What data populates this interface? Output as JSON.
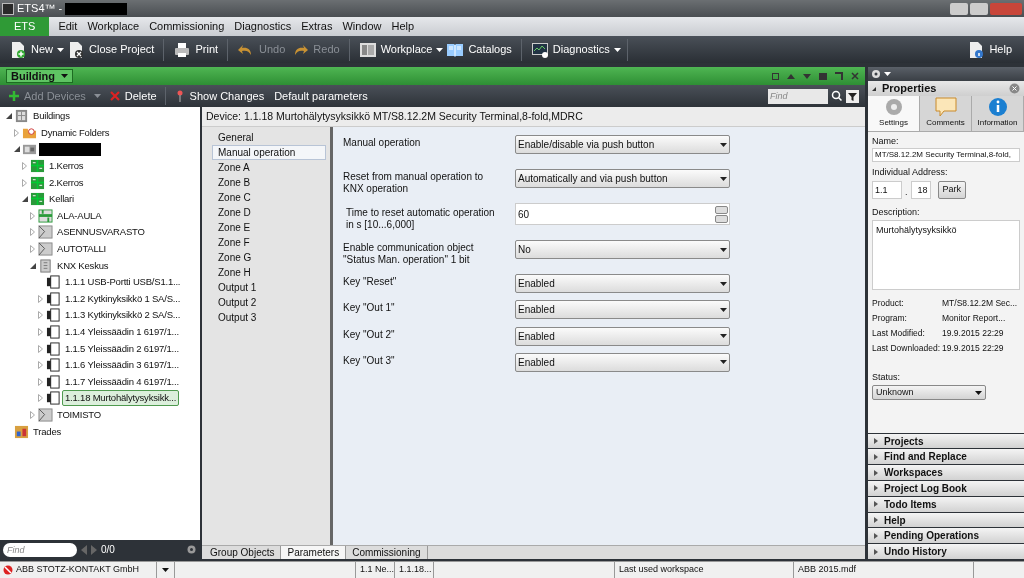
{
  "title_bar": {
    "title": "ETS4™ -"
  },
  "menu": [
    {
      "label": "ETS",
      "selected": true
    },
    {
      "label": "Edit",
      "selected": false
    },
    {
      "label": "Workplace",
      "selected": false
    },
    {
      "label": "Commissioning",
      "selected": false
    },
    {
      "label": "Diagnostics",
      "selected": false
    },
    {
      "label": "Extras",
      "selected": false
    },
    {
      "label": "Window",
      "selected": false
    },
    {
      "label": "Help",
      "selected": false
    }
  ],
  "toolbar": [
    {
      "label": "New",
      "disabled": false,
      "dropdown": true
    },
    {
      "label": "Close Project",
      "disabled": false,
      "dropdown": false
    },
    {
      "label": "Print",
      "disabled": false,
      "dropdown": false
    },
    {
      "label": "Undo",
      "disabled": true,
      "dropdown": false
    },
    {
      "label": "Redo",
      "disabled": true,
      "dropdown": false
    },
    {
      "label": "Workplace",
      "disabled": false,
      "dropdown": true
    },
    {
      "label": "Catalogs",
      "disabled": false,
      "dropdown": false
    },
    {
      "label": "Diagnostics",
      "disabled": false,
      "dropdown": true
    }
  ],
  "toolbar_right": {
    "label": "Help"
  },
  "building_panel": {
    "title": "Building",
    "actions": [
      {
        "label": "Add Devices",
        "disabled": true,
        "dropdown": true
      },
      {
        "label": "Delete",
        "disabled": false,
        "dropdown": false
      },
      {
        "label": "Show Changes",
        "disabled": false,
        "dropdown": false
      },
      {
        "label": "Default parameters",
        "disabled": false,
        "dropdown": false
      }
    ],
    "find_placeholder": "Find"
  },
  "tree": [
    {
      "label": "Buildings",
      "kind": "building",
      "expanded": true,
      "selected": false,
      "children": [
        {
          "label": "Dynamic Folders",
          "kind": "folder",
          "expanded": false,
          "selected": false
        },
        {
          "kind": "building-part",
          "expanded": true,
          "selected": false,
          "children": [
            {
              "label": "1.Kerros",
              "kind": "floor",
              "expanded": false,
              "selected": false
            },
            {
              "label": "2.Kerros",
              "kind": "floor",
              "expanded": false,
              "selected": false
            },
            {
              "label": "Kellari",
              "kind": "floor",
              "expanded": true,
              "selected": false,
              "children": [
                {
                  "label": "ALA-AULA",
                  "kind": "corridor",
                  "expanded": false,
                  "selected": false
                },
                {
                  "label": "ASENNUSVARASTO",
                  "kind": "room",
                  "expanded": false,
                  "selected": false
                },
                {
                  "label": "AUTOTALLI",
                  "kind": "room",
                  "expanded": false,
                  "selected": false
                },
                {
                  "label": "KNX Keskus",
                  "kind": "cabinet",
                  "expanded": true,
                  "selected": false,
                  "children": [
                    {
                      "label": "1.1.1 USB-Portti USB/S1.1...",
                      "kind": "device",
                      "selected": false
                    },
                    {
                      "label": "1.1.2 Kytkinyksikkö 1 SA/S...",
                      "kind": "device",
                      "expanded": false,
                      "selected": false
                    },
                    {
                      "label": "1.1.3 Kytkinyksikkö 2 SA/S...",
                      "kind": "device",
                      "expanded": false,
                      "selected": false
                    },
                    {
                      "label": "1.1.4 Yleissäädin 1 6197/1...",
                      "kind": "device",
                      "expanded": false,
                      "selected": false
                    },
                    {
                      "label": "1.1.5 Yleissäädin 2 6197/1...",
                      "kind": "device",
                      "expanded": false,
                      "selected": false
                    },
                    {
                      "label": "1.1.6 Yleissäädin 3 6197/1...",
                      "kind": "device",
                      "expanded": false,
                      "selected": false
                    },
                    {
                      "label": "1.1.7 Yleissäädin 4 6197/1...",
                      "kind": "device",
                      "expanded": false,
                      "selected": false
                    },
                    {
                      "label": "1.1.18 Murtohälytysyksikk...",
                      "kind": "device",
                      "expanded": false,
                      "selected": true
                    }
                  ]
                },
                {
                  "label": "TOIMISTO",
                  "kind": "room",
                  "expanded": false,
                  "selected": false
                }
              ]
            }
          ]
        }
      ]
    },
    {
      "label": "Trades",
      "kind": "trades",
      "selected": false
    }
  ],
  "tree_footer": {
    "find_placeholder": "Find",
    "count": "0/0"
  },
  "device_header": "Device: 1.1.18 Murtohälytysyksikkö MT/S8.12.2M Security Terminal,8-fold,MDRC",
  "param_pages": [
    {
      "label": "General",
      "selected": false
    },
    {
      "label": "Manual operation",
      "selected": true
    },
    {
      "label": "Zone A",
      "selected": false
    },
    {
      "label": "Zone B",
      "selected": false
    },
    {
      "label": "Zone C",
      "selected": false
    },
    {
      "label": "Zone D",
      "selected": false
    },
    {
      "label": "Zone E",
      "selected": false
    },
    {
      "label": "Zone F",
      "selected": false
    },
    {
      "label": "Zone G",
      "selected": false
    },
    {
      "label": "Zone H",
      "selected": false
    },
    {
      "label": "Output 1",
      "selected": false
    },
    {
      "label": "Output 2",
      "selected": false
    },
    {
      "label": "Output 3",
      "selected": false
    }
  ],
  "params": [
    {
      "label": "Manual operation",
      "kind": "dropdown",
      "value": "Enable/disable via push button"
    },
    {
      "label": "Reset from manual operation to KNX operation",
      "kind": "dropdown",
      "value": "Automatically and via push button"
    },
    {
      "label": "Time to reset automatic operation in s [10...6,000]",
      "kind": "spin",
      "value": "60"
    },
    {
      "label": "Enable communication object \"Status Man. operation\" 1 bit",
      "kind": "dropdown",
      "value": "No"
    },
    {
      "label": "Key \"Reset\"",
      "kind": "dropdown",
      "value": "Enabled"
    },
    {
      "label": "Key \"Out 1\"",
      "kind": "dropdown",
      "value": "Enabled"
    },
    {
      "label": "Key \"Out 2\"",
      "kind": "dropdown",
      "value": "Enabled"
    },
    {
      "label": "Key \"Out 3\"",
      "kind": "dropdown",
      "value": "Enabled"
    }
  ],
  "bottom_tabs": [
    {
      "label": "Group Objects",
      "selected": false
    },
    {
      "label": "Parameters",
      "selected": true
    },
    {
      "label": "Commissioning",
      "selected": false
    }
  ],
  "properties": {
    "title": "Properties",
    "tabs": [
      {
        "label": "Settings",
        "selected": true
      },
      {
        "label": "Comments",
        "selected": false
      },
      {
        "label": "Information",
        "selected": false
      }
    ],
    "name_label": "Name:",
    "name_value": "MT/S8.12.2M Security Terminal,8-fold,",
    "address_label": "Individual Address:",
    "address_line": "1.1",
    "address_sep": ".",
    "address_device": "18",
    "park_button": "Park",
    "description_label": "Description:",
    "description_value": "Murtohälytysyksikkö",
    "info": [
      {
        "label": "Product:",
        "value": "MT/S8.12.2M Sec..."
      },
      {
        "label": "Program:",
        "value": "Monitor Report..."
      },
      {
        "label": "Last Modified:",
        "value": "19.9.2015 22:29"
      },
      {
        "label": "Last Downloaded:",
        "value": "19.9.2015 22:29"
      }
    ],
    "status_label": "Status:",
    "status_value": "Unknown"
  },
  "side_panels": [
    {
      "label": "Projects",
      "expanded": false
    },
    {
      "label": "Find and Replace",
      "expanded": false
    },
    {
      "label": "Workspaces",
      "expanded": false
    },
    {
      "label": "Project Log Book",
      "expanded": false
    },
    {
      "label": "Todo Items",
      "expanded": false
    },
    {
      "label": "Help",
      "expanded": false
    },
    {
      "label": "Pending Operations",
      "expanded": false
    },
    {
      "label": "Undo History",
      "expanded": false
    }
  ],
  "status_bar": {
    "company": "ABB STOTZ-KONTAKT GmbH",
    "cells": [
      "1.1 Ne...",
      "1.1.18...",
      "Last used workspace",
      "ABB 2015.mdf"
    ]
  }
}
